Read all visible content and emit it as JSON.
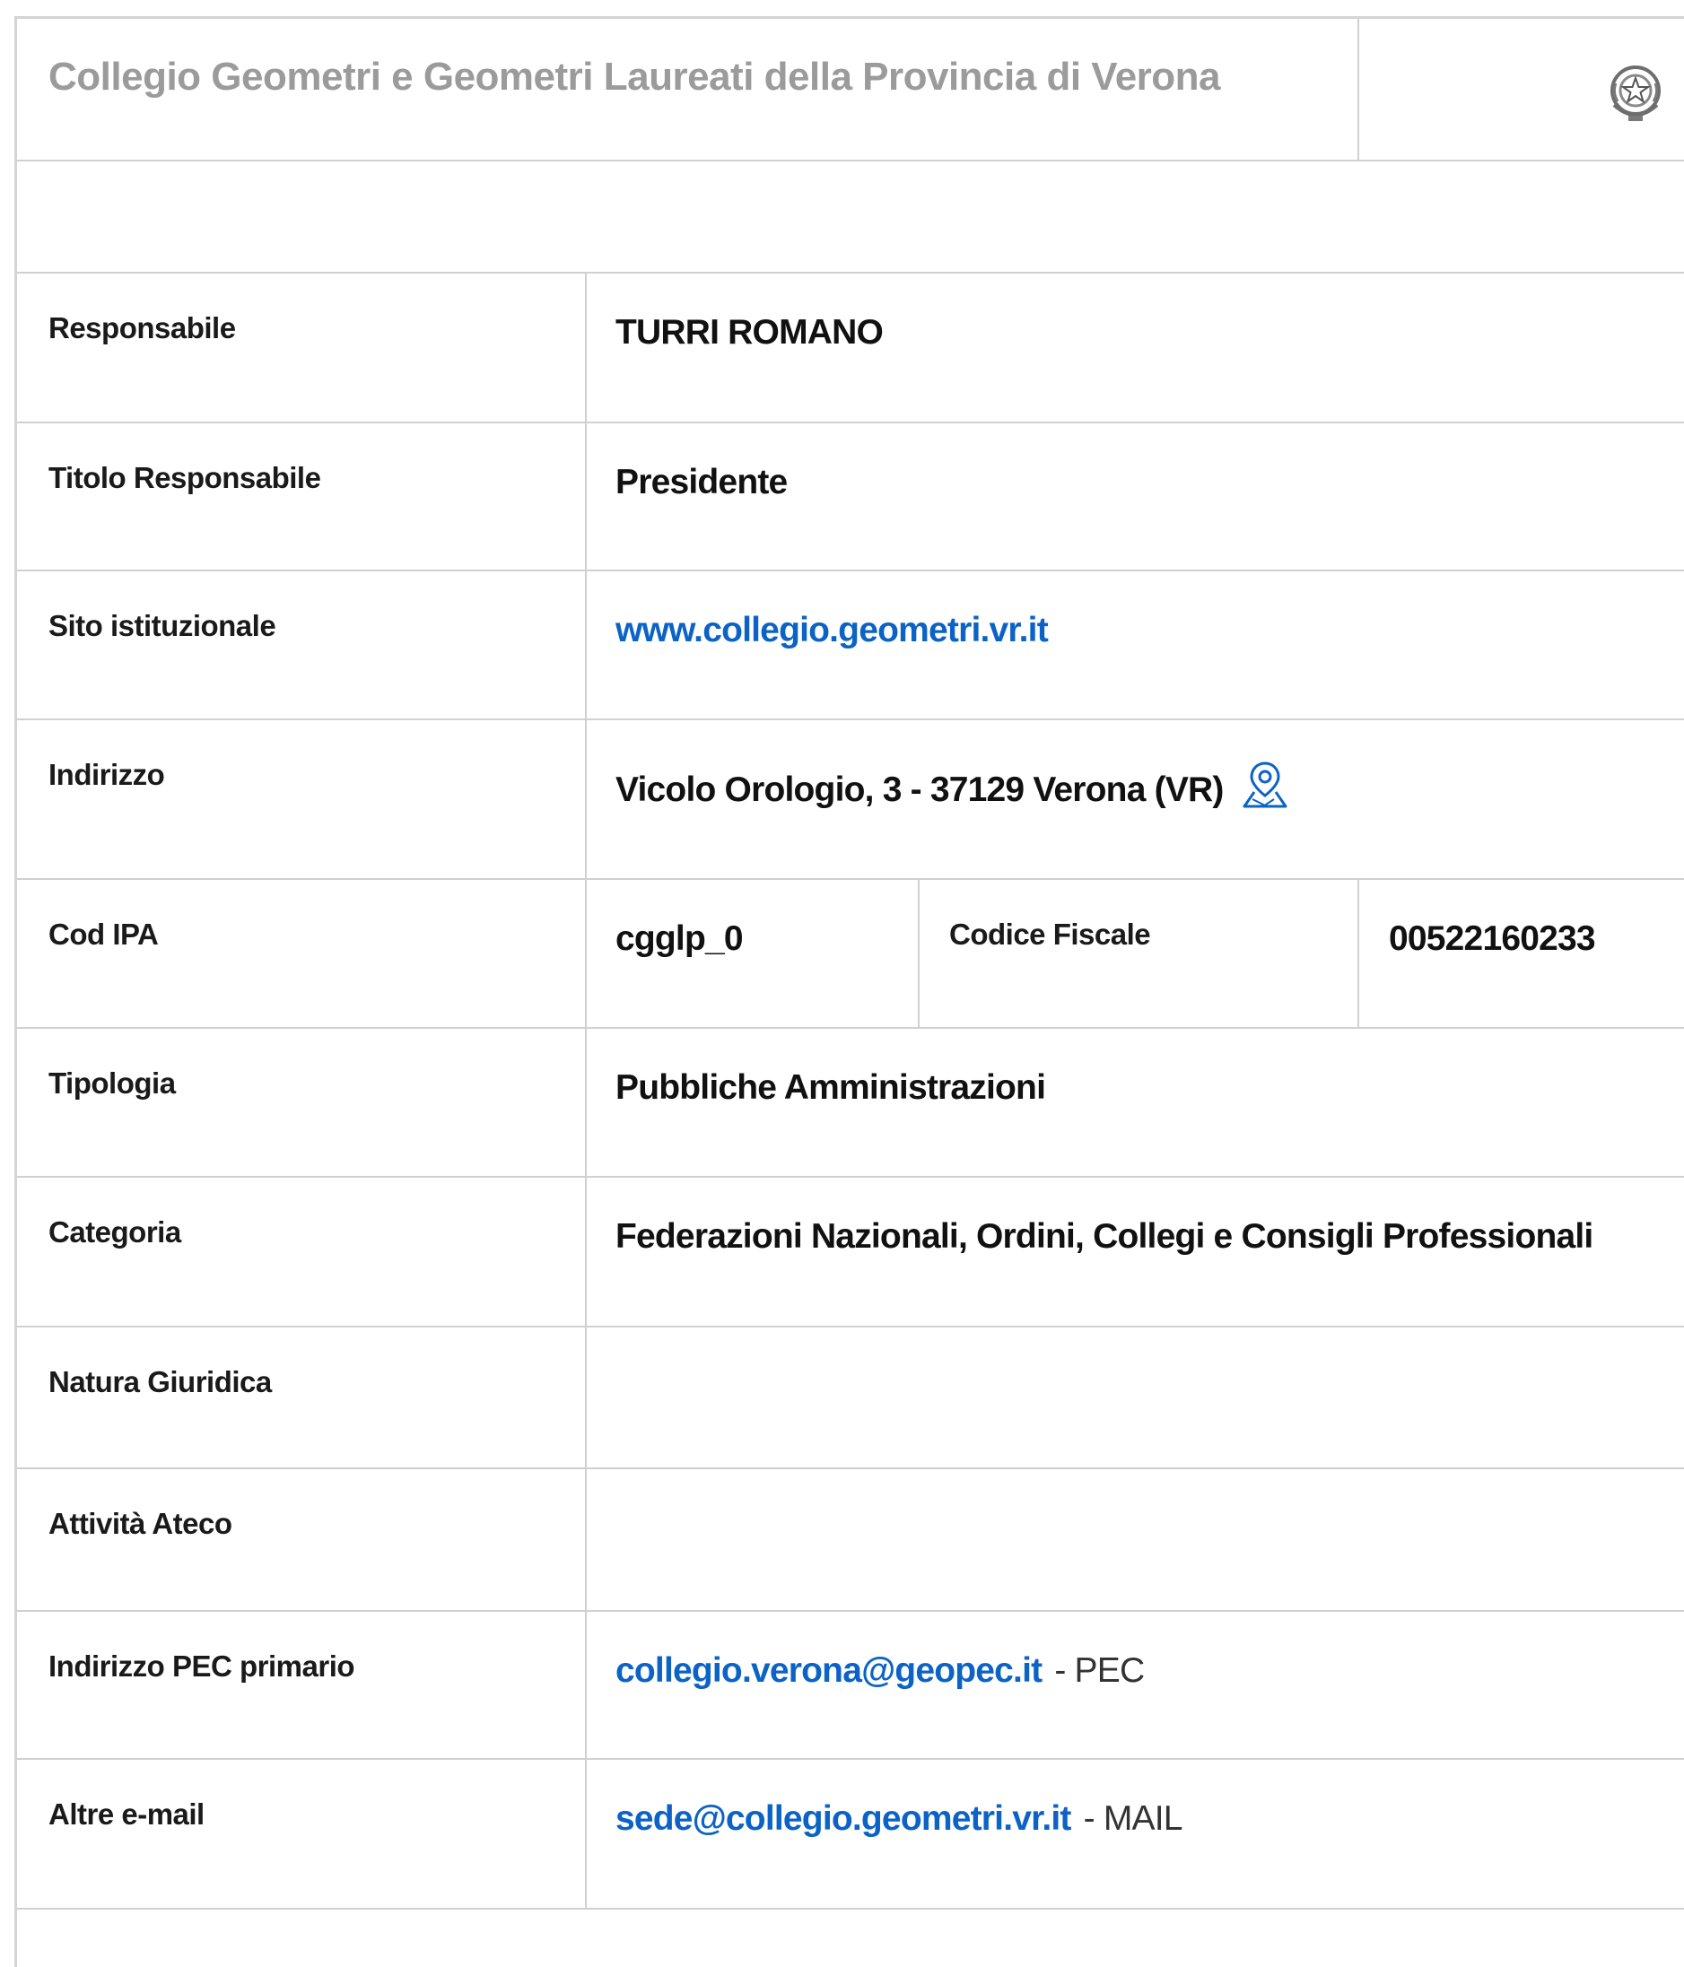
{
  "header": {
    "title": "Collegio Geometri e Geometri Laureati della Provincia di Verona",
    "emblem_icon": "italian-republic-emblem-icon"
  },
  "rows": {
    "responsabile": {
      "label": "Responsabile",
      "value": "TURRI ROMANO"
    },
    "titolo": {
      "label": "Titolo Responsabile",
      "value": "Presidente"
    },
    "sito": {
      "label": "Sito istituzionale",
      "value": "www.collegio.geometri.vr.it"
    },
    "indirizzo": {
      "label": "Indirizzo",
      "value": "Vicolo Orologio, 3 - 37129 Verona (VR)",
      "icon": "map-pin-icon"
    },
    "codipa": {
      "label": "Cod IPA",
      "value": "cgglp_0",
      "label2": "Codice Fiscale",
      "value2": "00522160233"
    },
    "tipologia": {
      "label": "Tipologia",
      "value": "Pubbliche Amministrazioni"
    },
    "categoria": {
      "label": "Categoria",
      "value": "Federazioni Nazionali, Ordini, Collegi e Consigli Professionali"
    },
    "natura": {
      "label": "Natura Giuridica",
      "value": ""
    },
    "ateco": {
      "label": "Attività Ateco",
      "value": ""
    },
    "pec": {
      "label": "Indirizzo PEC primario",
      "value": "collegio.verona@geopec.it",
      "suffix": "- PEC"
    },
    "mail": {
      "label": "Altre e-mail",
      "value": "sede@collegio.geometri.vr.it",
      "suffix": "- MAIL"
    }
  },
  "colors": {
    "link": "#0b63c6",
    "header_text": "#9b9b9b",
    "border": "#d0d0d0"
  }
}
